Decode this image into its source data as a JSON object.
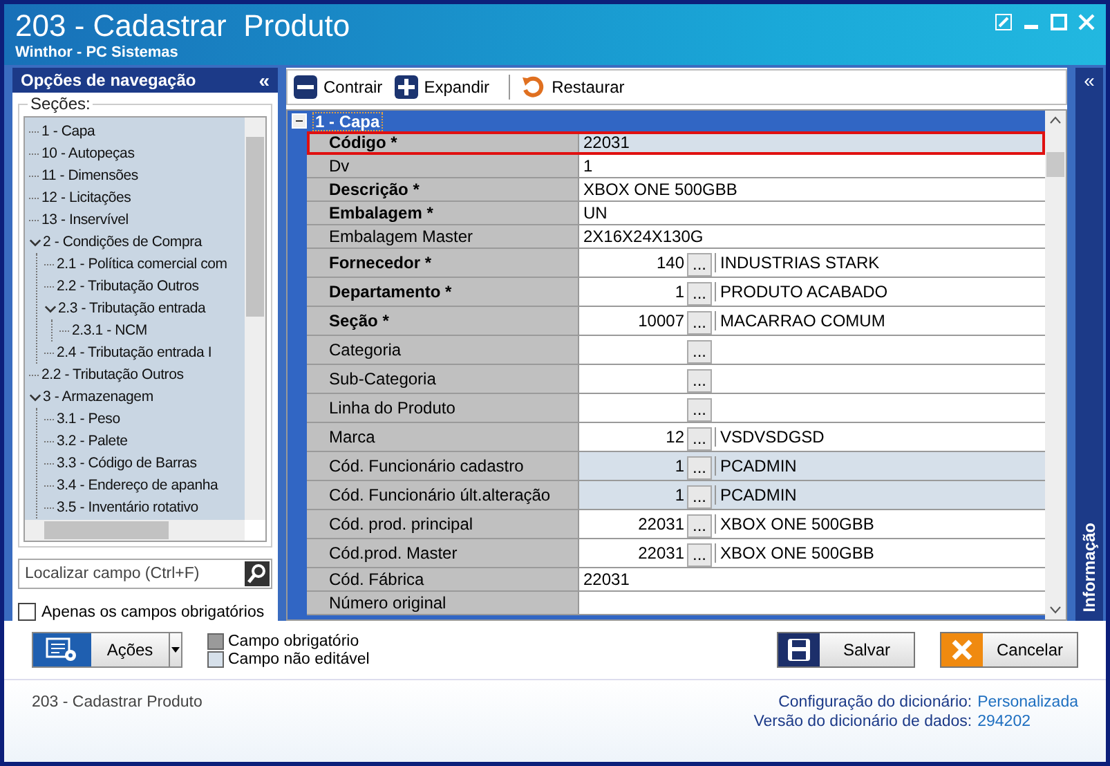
{
  "window": {
    "title": "203 - Cadastrar  Produto",
    "subtitle": "Winthor - PC Sistemas"
  },
  "navigation": {
    "title": "Opções de navegação",
    "collapse": "«",
    "group_label": "Seções:",
    "tree": [
      {
        "label": "1 - Capa"
      },
      {
        "label": "10 - Autopeças"
      },
      {
        "label": "11 - Dimensões"
      },
      {
        "label": "12 - Licitações"
      },
      {
        "label": "13 - Inservível"
      },
      {
        "label": "2 - Condições de Compra",
        "expanded": true,
        "children": [
          {
            "label": "2.1 - Política comercial com"
          },
          {
            "label": "2.2 - Tributação Outros"
          },
          {
            "label": "2.3 - Tributação entrada",
            "expanded": true,
            "children": [
              {
                "label": "2.3.1 - NCM"
              }
            ]
          },
          {
            "label": "2.4 - Tributação entrada I"
          }
        ]
      },
      {
        "label": "2.2 - Tributação Outros"
      },
      {
        "label": "3 - Armazenagem",
        "expanded": true,
        "children": [
          {
            "label": "3.1 - Peso"
          },
          {
            "label": "3.2 - Palete"
          },
          {
            "label": "3.3 - Código de Barras"
          },
          {
            "label": "3.4 - Endereço de apanha"
          },
          {
            "label": "3.5 - Inventário rotativo"
          }
        ]
      }
    ],
    "search": {
      "placeholder": "Localizar campo (Ctrl+F)"
    },
    "only_required": {
      "label": "Apenas os campos obrigatórios",
      "checked": false
    }
  },
  "toolbar": [
    {
      "label": "Contrair",
      "kind": "collapse"
    },
    {
      "label": "Expandir",
      "kind": "expand"
    },
    {
      "label": "Restaurar",
      "kind": "restore"
    }
  ],
  "section": {
    "title": "1 - Capa",
    "expanded": true
  },
  "fields": [
    {
      "label": "Código *",
      "kind": "text",
      "value": "22031",
      "required": true,
      "editable": false,
      "highlighted": true
    },
    {
      "label": "Dv",
      "kind": "text",
      "value": "1",
      "required": false,
      "editable": true,
      "highlighted": false
    },
    {
      "label": "Descrição *",
      "kind": "text",
      "value": "XBOX ONE 500GBB",
      "required": true,
      "editable": true,
      "highlighted": false
    },
    {
      "label": "Embalagem *",
      "kind": "text",
      "value": "UN",
      "required": true,
      "editable": true,
      "highlighted": false
    },
    {
      "label": "Embalagem Master",
      "kind": "text",
      "value": "2X16X24X130G",
      "required": false,
      "editable": true,
      "highlighted": false
    },
    {
      "label": "Fornecedor *",
      "kind": "lookup",
      "code": "140",
      "button": "...",
      "description": "INDUSTRIAS STARK",
      "required": true,
      "editable": true,
      "highlighted": false
    },
    {
      "label": "Departamento *",
      "kind": "lookup",
      "code": "1",
      "button": "...",
      "description": "PRODUTO ACABADO",
      "required": true,
      "editable": true,
      "highlighted": false
    },
    {
      "label": "Seção *",
      "kind": "lookup",
      "code": "10007",
      "button": "...",
      "description": "MACARRAO COMUM",
      "required": true,
      "editable": true,
      "highlighted": false
    },
    {
      "label": "Categoria",
      "kind": "lookup",
      "button": "...",
      "required": false,
      "editable": true,
      "highlighted": false
    },
    {
      "label": "Sub-Categoria",
      "kind": "lookup",
      "button": "...",
      "required": false,
      "editable": true,
      "highlighted": false
    },
    {
      "label": "Linha do Produto",
      "kind": "lookup",
      "button": "...",
      "required": false,
      "editable": true,
      "highlighted": false
    },
    {
      "label": "Marca",
      "kind": "lookup",
      "code": "12",
      "button": "...",
      "description": "VSDVSDGSD",
      "required": false,
      "editable": true,
      "highlighted": false
    },
    {
      "label": "Cód. Funcionário cadastro",
      "kind": "lookup",
      "code": "1",
      "button": "...",
      "description": "PCADMIN",
      "required": false,
      "editable": false,
      "highlighted": false
    },
    {
      "label": "Cód. Funcionário últ.alteração",
      "kind": "lookup",
      "code": "1",
      "button": "...",
      "description": "PCADMIN",
      "required": false,
      "editable": false,
      "highlighted": false
    },
    {
      "label": "Cód. prod. principal",
      "kind": "lookup",
      "code": "22031",
      "button": "...",
      "description": "XBOX ONE 500GBB",
      "required": false,
      "editable": true,
      "highlighted": false
    },
    {
      "label": "Cód.prod. Master",
      "kind": "lookup",
      "code": "22031",
      "button": "...",
      "description": "XBOX ONE 500GBB",
      "required": false,
      "editable": true,
      "highlighted": false
    },
    {
      "label": "Cód. Fábrica",
      "kind": "text",
      "value": "22031",
      "required": false,
      "editable": true,
      "highlighted": false
    },
    {
      "label": "Número original",
      "kind": "text",
      "required": false,
      "editable": true,
      "highlighted": false
    }
  ],
  "info_panel": {
    "collapse": "«",
    "label": "Informação"
  },
  "actions_button": {
    "label": "Ações"
  },
  "legend": [
    {
      "label": "Campo obrigatório",
      "kind": "required"
    },
    {
      "label": "Campo não editável",
      "kind": "readonly"
    }
  ],
  "buttons": [
    {
      "label": "Salvar",
      "kind": "save"
    },
    {
      "label": "Cancelar",
      "kind": "cancel"
    }
  ],
  "status_bar": {
    "program": "203 - Cadastrar  Produto",
    "lines": [
      {
        "label": "Configuração do dicionário:",
        "value": "Personalizada"
      },
      {
        "label": "Versão do dicionário de dados:",
        "value": "294202"
      }
    ]
  }
}
